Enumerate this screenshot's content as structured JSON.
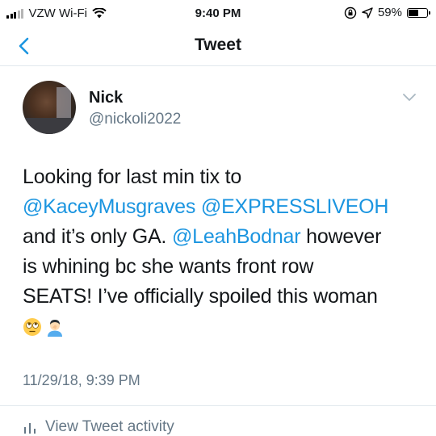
{
  "status_bar": {
    "carrier": "VZW Wi-Fi",
    "time": "9:40 PM",
    "battery_percent": "59%",
    "battery_level": 0.59,
    "icons": [
      "signal-icon",
      "wifi-icon",
      "screen-lock-icon",
      "location-icon",
      "battery-icon"
    ]
  },
  "nav": {
    "title": "Tweet",
    "back_icon": "chevron-left-icon"
  },
  "tweet": {
    "display_name": "Nick",
    "handle": "@nickoli2022",
    "text_parts": {
      "p1": "Looking for last min tix to",
      "m1": "@KaceyMusgraves",
      "m2": "@EXPRESSLIVEOH",
      "p2": "and it’s only GA.",
      "m3": "@LeahBodnar",
      "p3": "however",
      "p4": "is whining bc she wants front row",
      "p5": "SEATS! I’ve officially spoiled this woman"
    },
    "emojis": [
      "eye-roll-emoji",
      "facepalm-emoji"
    ],
    "timestamp": "11/29/18, 9:39 PM"
  },
  "activity": {
    "label": "View Tweet activity",
    "icon": "bar-chart-icon"
  },
  "colors": {
    "link": "#1b95e0",
    "secondary_text": "#657786",
    "divider": "#e1e8ed"
  }
}
